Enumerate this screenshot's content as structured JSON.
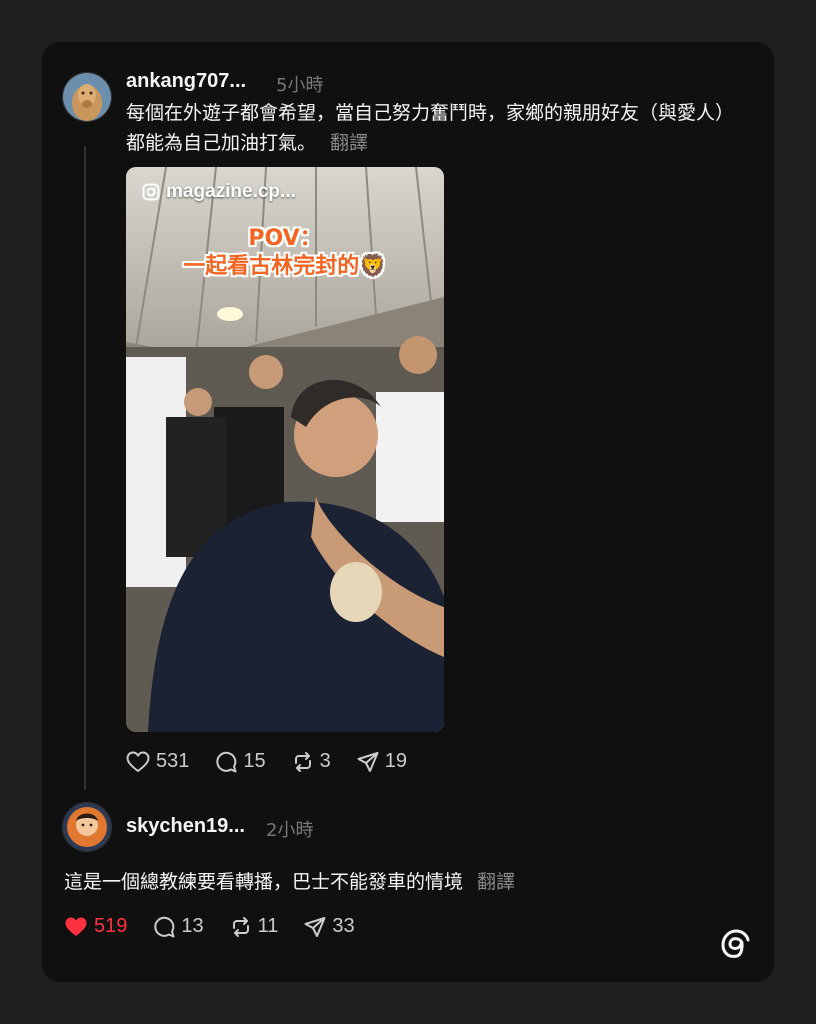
{
  "post": {
    "username": "ankang707...",
    "time": "5小時",
    "text": "每個在外遊子都會希望，當自己努力奮鬥時，家鄉的親朋好友（與愛人）都能為自己加油打氣。",
    "translate": "翻譯",
    "media": {
      "handle": "magazine.cp...",
      "caption_line1": "POV：",
      "caption_line2": "一起看古林完封的🦁"
    },
    "likes": "531",
    "comments": "15",
    "reposts": "3",
    "shares": "19"
  },
  "reply": {
    "username": "skychen19...",
    "time": "2小時",
    "text": "這是一個總教練要看轉播，巴士不能發車的情境",
    "translate": "翻譯",
    "likes": "519",
    "comments": "13",
    "reposts": "11",
    "shares": "33"
  },
  "colors": {
    "background": "#1f1f1f",
    "card": "#101010",
    "like_active": "#ff3040",
    "muted": "#777777"
  },
  "icons": [
    "heart-icon",
    "comment-icon",
    "repost-icon",
    "share-icon",
    "instagram-icon",
    "threads-logo-icon"
  ]
}
